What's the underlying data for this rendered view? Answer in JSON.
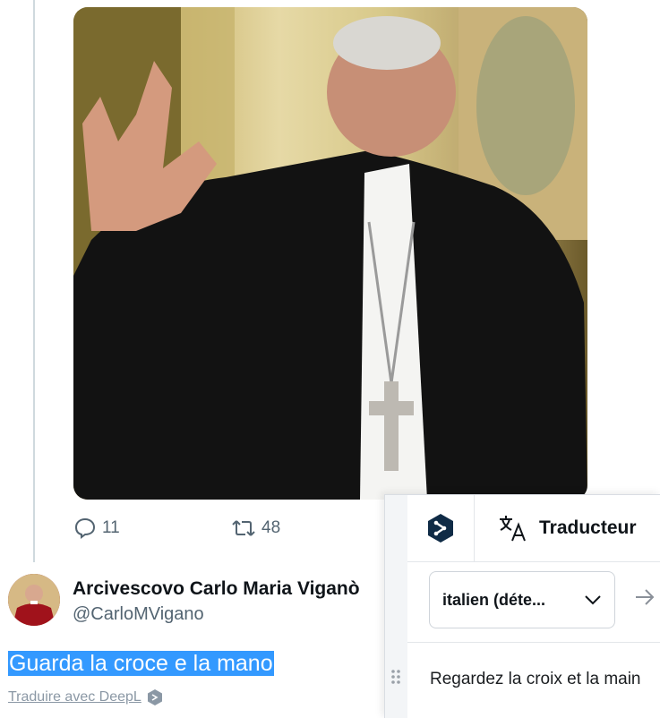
{
  "tweet": {
    "reply_count": "11",
    "retweet_count": "48",
    "author_name": "Arcivescovo Carlo Maria Viganò",
    "author_handle": "@CarloMVigano",
    "text": "Guarda la croce e la mano",
    "translate_link": "Traduire avec DeepL"
  },
  "deepl": {
    "title": "Traducteur",
    "source_language": "italien (déte...",
    "translation": "Regardez la croix et la main"
  },
  "colors": {
    "selection": "#3399ff",
    "deepl_navy": "#0f2b46",
    "muted": "#536471"
  },
  "icons": [
    "reply-icon",
    "retweet-icon",
    "deepl-logo-icon",
    "translate-icon",
    "chevron-down-icon",
    "arrow-right-icon",
    "drag-handle-icon"
  ]
}
